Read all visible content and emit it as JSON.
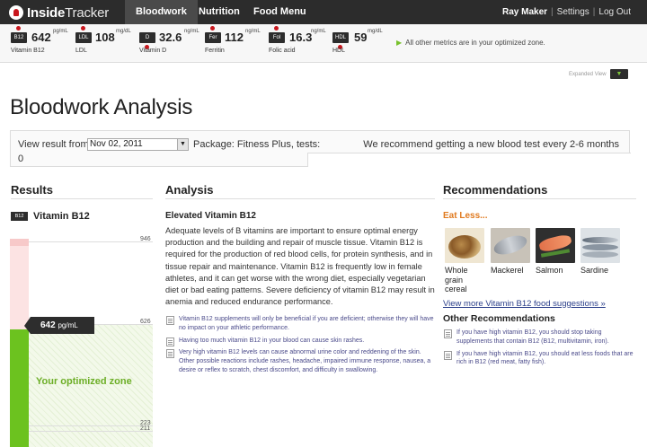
{
  "app": {
    "logo_text_bold": "Inside",
    "logo_text_light": "Tracker"
  },
  "nav": {
    "tabs": [
      {
        "label": "Bloodwork",
        "active": true
      },
      {
        "label": "Nutrition",
        "active": false
      },
      {
        "label": "Food Menu",
        "active": false
      }
    ],
    "user_name": "Ray Maker",
    "settings_label": "Settings",
    "logout_label": "Log Out",
    "separator": "|"
  },
  "metrics": {
    "items": [
      {
        "badge": "B12",
        "value": "642",
        "unit": "pg/mL",
        "name": "Vitamin B12",
        "dot": "above"
      },
      {
        "badge": "LDL",
        "value": "108",
        "unit": "mg/dL",
        "name": "LDL",
        "dot": "above"
      },
      {
        "badge": "D",
        "value": "32.6",
        "unit": "ng/mL",
        "name": "Vitamin D",
        "dot": "below"
      },
      {
        "badge": "Fer",
        "value": "112",
        "unit": "ng/mL",
        "name": "Ferritin",
        "dot": "above"
      },
      {
        "badge": "Fol",
        "value": "16.3",
        "unit": "ng/mL",
        "name": "Folic acid",
        "dot": "above"
      },
      {
        "badge": "HDL",
        "value": "59",
        "unit": "mg/dL",
        "name": "HDL",
        "dot": "below"
      }
    ],
    "optimized_note": "All other metrics are in your optimized zone.",
    "expanded_view_label": "Expanded View"
  },
  "page": {
    "title": "Bloodwork Analysis"
  },
  "result_box": {
    "label": "View result from",
    "selected_date": "Nov 02, 2011",
    "package_text": "Package: Fitness Plus, tests:",
    "package_count": "0",
    "recommend_text": "We recommend getting a new blood test every 2-6 months"
  },
  "results": {
    "heading": "Results",
    "badge": "B12",
    "metric_name": "Vitamin B12",
    "value_display": "642",
    "unit": "pg/mL",
    "zone_label": "Your optimized zone",
    "ticks": [
      {
        "label": "946"
      },
      {
        "label": "626"
      },
      {
        "label": "223"
      },
      {
        "label": "211"
      }
    ],
    "gauge_scale": {
      "min": 211,
      "max": 946,
      "value": 642,
      "zone_low": 223,
      "zone_high": 626
    }
  },
  "analysis": {
    "heading": "Analysis",
    "title": "Elevated Vitamin B12",
    "body": "Adequate levels of B vitamins are important to ensure optimal energy production and the building and repair of muscle tissue. Vitamin B12 is required for the production of red blood cells, for protein synthesis, and in tissue repair and maintenance. Vitamin B12 is frequently low in female athletes, and it can get worse with the wrong diet, especially vegetarian diet or bad eating patterns. Severe deficiency of vitamin B12 may result in anemia and reduced endurance performance.",
    "notes": [
      "Vitamin B12 supplements will only be beneficial if you are deficient; otherwise they will have no impact on your athletic performance.",
      "Having too much vitamin B12 in your blood can cause skin rashes.",
      "Very high vitamin B12 levels can cause abnormal urine color and reddening of the skin. Other possible reactions include rashes, headache, impaired immune response, nausea, a desire or reflex to scratch, chest discomfort, and difficulty in swallowing."
    ]
  },
  "recommendations": {
    "heading": "Recommendations",
    "eat_less_label": "Eat Less...",
    "foods": [
      {
        "label": "Whole grain cereal",
        "icon": "cereal-photo"
      },
      {
        "label": "Mackerel",
        "icon": "mackerel-photo"
      },
      {
        "label": "Salmon",
        "icon": "salmon-photo"
      },
      {
        "label": "Sardine",
        "icon": "sardine-photo"
      }
    ],
    "view_more_label": "View more Vitamin B12 food suggestions »",
    "other_heading": "Other Recommendations",
    "other_items": [
      "If you have high vitamin B12, you should stop taking supplements that contain B12 (B12, multivitamin, iron).",
      "If you have high vitamin B12, you should eat less foods that are rich in B12 (red meat, fatty fish)."
    ]
  },
  "colors": {
    "nav_bg": "#2c2c2c",
    "accent_green": "#6cc21f",
    "accent_red": "#c8161d",
    "eat_less_orange": "#e07a1f",
    "link_blue": "#2b3f8a"
  }
}
